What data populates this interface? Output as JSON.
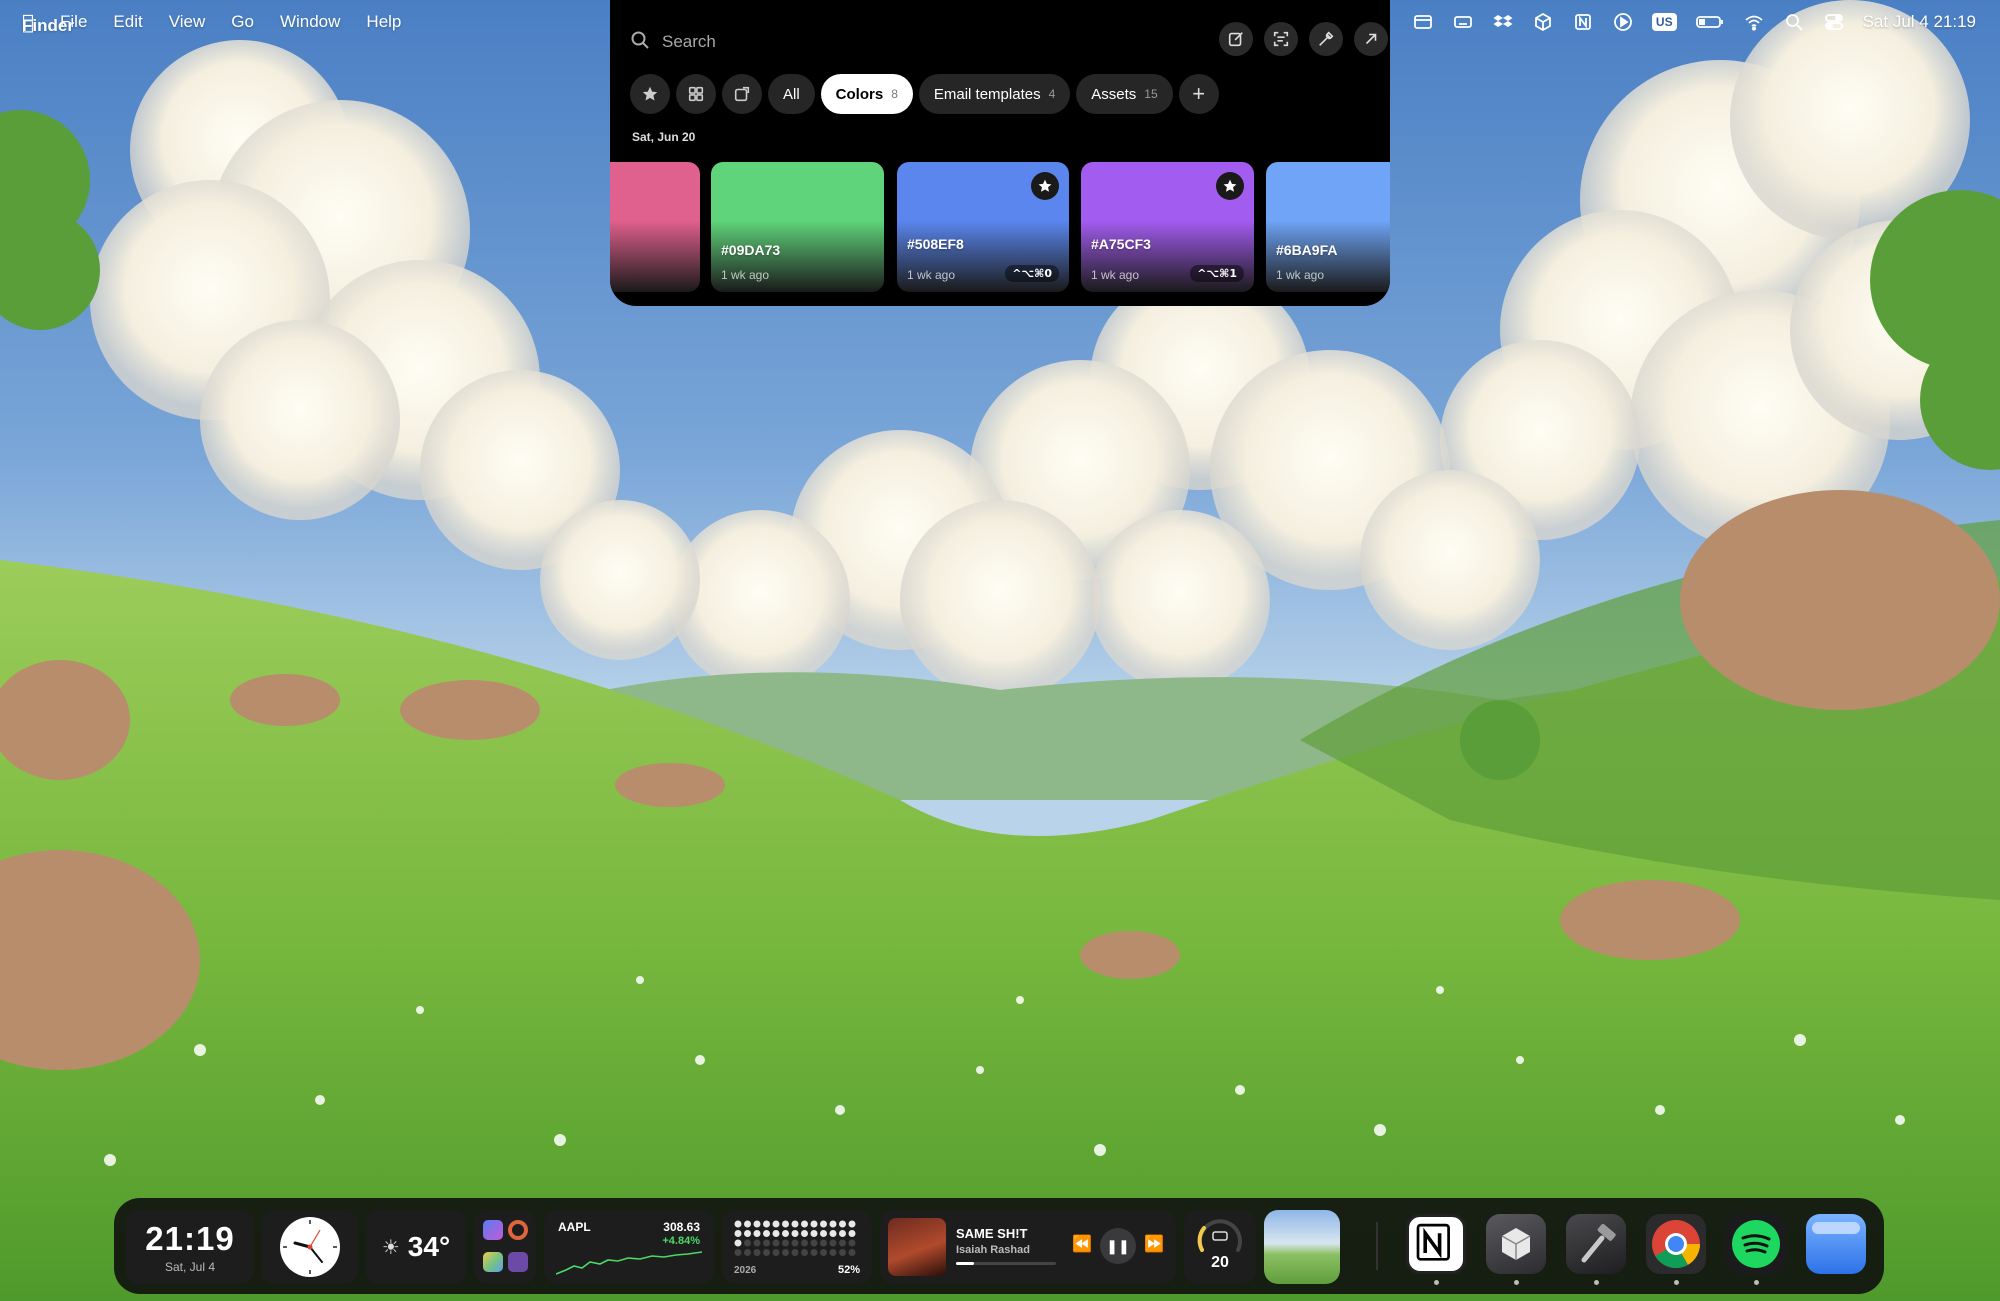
{
  "menubar": {
    "apple_icon": "apple-logo",
    "app_name": "Finder",
    "menus": [
      "File",
      "Edit",
      "View",
      "Go",
      "Window",
      "Help"
    ],
    "status_icons": [
      "window-icon",
      "keyboard-icon",
      "dropbox-icon",
      "box-icon",
      "notion-icon",
      "play-icon"
    ],
    "keyboard_layout": "US",
    "datetime": "Sat Jul 4  21:19"
  },
  "clipboard": {
    "search_placeholder": "Search",
    "toolbar_icons": [
      "edit-icon",
      "scan-icon",
      "eyedropper-icon",
      "expand-icon"
    ],
    "filter_icons": [
      "star-icon",
      "grid-icon",
      "screenshot-icon"
    ],
    "tabs": [
      {
        "label": "All",
        "count": ""
      },
      {
        "label": "Colors",
        "count": "8",
        "active": true
      },
      {
        "label": "Email templates",
        "count": "4"
      },
      {
        "label": "Assets",
        "count": "15"
      }
    ],
    "add_label": "+",
    "date_label": "Sat, Jun 20",
    "cards": [
      {
        "hex": "",
        "ago": "",
        "color": "#E0608E",
        "starred": false,
        "shortcut": ""
      },
      {
        "hex": "#09DA73",
        "ago": "1 wk ago",
        "color": "#5FD47A",
        "starred": false,
        "shortcut": ""
      },
      {
        "hex": "#508EF8",
        "ago": "1 wk ago",
        "color": "#5A86EE",
        "starred": true,
        "shortcut": "^⌥⌘0"
      },
      {
        "hex": "#A75CF3",
        "ago": "1 wk ago",
        "color": "#A35CF0",
        "starred": true,
        "shortcut": "^⌥⌘1"
      },
      {
        "hex": "#6BA9FA",
        "ago": "1 wk ago",
        "color": "#6FA4F6",
        "starred": false,
        "shortcut": ""
      }
    ]
  },
  "dock": {
    "time_widget": {
      "time": "21:19",
      "date": "Sat, Jul 4"
    },
    "weather_widget": {
      "temp": "34°",
      "icon": "sun-icon"
    },
    "stock_widget": {
      "symbol": "AAPL",
      "price": "308.63",
      "change": "+4.84%"
    },
    "year_widget": {
      "year": "2026",
      "percent": "52%",
      "fraction": 0.52
    },
    "music_widget": {
      "title": "SAME SH!T",
      "artist": "Isaiah Rashad",
      "progress": 0.18
    },
    "battery_widget": {
      "value": "20"
    },
    "apps": [
      {
        "name": "notion-app",
        "running": true
      },
      {
        "name": "box-app",
        "running": true
      },
      {
        "name": "xcode-hammer-app",
        "running": true
      },
      {
        "name": "chrome-app",
        "running": true
      },
      {
        "name": "spotify-app",
        "running": true
      },
      {
        "name": "finder-app",
        "running": false
      }
    ]
  },
  "colors": {
    "accent_green": "#4CD964",
    "panel_bg": "#000000"
  }
}
